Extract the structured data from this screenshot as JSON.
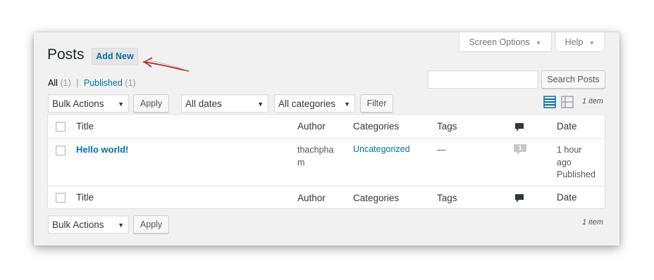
{
  "screen_options": {
    "label": "Screen Options"
  },
  "help": {
    "label": "Help"
  },
  "page_title": "Posts",
  "add_new": "Add New",
  "subsubsub": {
    "all_label": "All",
    "all_count": "(1)",
    "separator": "|",
    "published_label": "Published",
    "published_count": "(1)"
  },
  "search": {
    "placeholder": "",
    "button": "Search Posts"
  },
  "top_nav": {
    "bulk_actions": "Bulk Actions",
    "apply": "Apply",
    "dates": "All dates",
    "categories": "All categories",
    "filter": "Filter",
    "items_count": "1 item"
  },
  "view_modes": [
    "list-view-icon",
    "excerpt-view-icon"
  ],
  "table": {
    "columns": [
      "Title",
      "Author",
      "Categories",
      "Tags",
      "comments-icon",
      "Date"
    ],
    "rows": [
      {
        "title": "Hello world!",
        "author_line1": "thachpha",
        "author_line2": "m",
        "categories": "Uncategorized",
        "tags": "—",
        "comments": "1",
        "date_line1": "1 hour",
        "date_line2": "ago",
        "date_line3": "Published"
      }
    ]
  },
  "bottom_nav": {
    "bulk_actions": "Bulk Actions",
    "apply": "Apply",
    "items_count": "1 item"
  },
  "colors": {
    "link": "#0073aa",
    "arrow": "#b02a2a",
    "active_view_icon": "#0073aa"
  }
}
